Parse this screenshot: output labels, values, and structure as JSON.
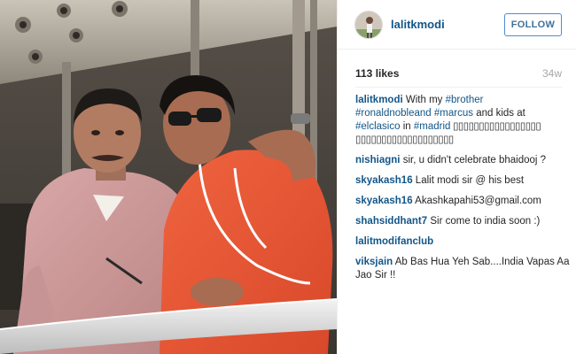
{
  "post": {
    "username": "lalitkmodi",
    "follow_label": "FOLLOW",
    "likes": "113 likes",
    "age": "34w"
  },
  "caption": {
    "user": "lalitkmodi",
    "t1": "With my ",
    "tag1": "#brother",
    "tag2": "#ronaldnobleand",
    "tag3": "#marcus",
    "t2": " and kids at",
    "tag4": "#elclasico",
    "t3": " in ",
    "tag5": "#madrid",
    "squares1": " ▯▯▯▯▯▯▯▯▯▯▯▯▯▯▯▯▯",
    "squares2": "▯▯▯▯▯▯▯▯▯▯▯▯▯▯▯▯▯▯▯"
  },
  "comments": [
    {
      "user": "nishiagni",
      "text": "sir, u didn't celebrate bhaidooj ?"
    },
    {
      "user": "skyakash16",
      "text": "Lalit modi sir @ his best"
    },
    {
      "user": "skyakash16",
      "text": "Akashkapahi53@gmail.com"
    },
    {
      "user": "shahsiddhant7",
      "text": "Sir come to india soon :)"
    },
    {
      "user": "lalitmodifanclub",
      "text": ""
    },
    {
      "user": "viksjain",
      "text": "Ab Bas Hua Yeh Sab....India Vapas Aa Jao Sir !!"
    }
  ],
  "colors": {
    "link": "#125688",
    "follow_border": "#4e8ccf",
    "muted": "#a5a7aa"
  },
  "icons": {
    "avatar": "user-avatar"
  }
}
